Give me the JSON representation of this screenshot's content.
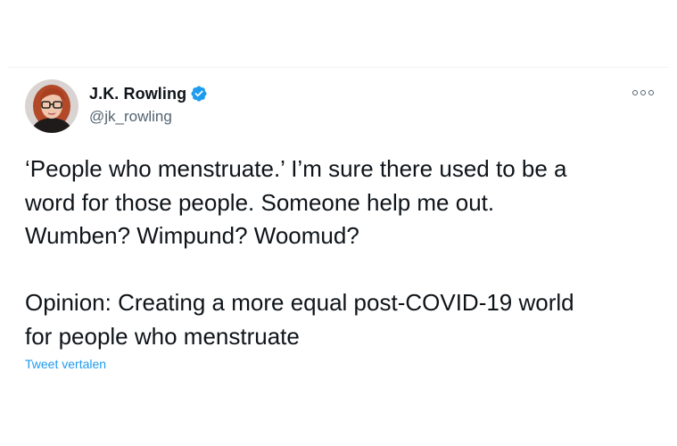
{
  "tweet": {
    "author": {
      "display_name": "J.K. Rowling",
      "handle": "@jk_rowling",
      "verified": true,
      "avatar_icon": "profile-photo-icon"
    },
    "more_icon": "more-options-icon",
    "text_lines_1": [
      "‘People who menstruate.’ I’m sure there used to be a",
      "word for those people. Someone help me out.",
      "Wumben? Wimpund? Woomud?"
    ],
    "text_lines_2": [
      "Opinion: Creating a more equal post-COVID-19 world",
      "for people who menstruate"
    ],
    "translate_label": "Tweet vertalen"
  },
  "colors": {
    "text_primary": "#0f1419",
    "text_secondary": "#536471",
    "accent": "#1d9bf0",
    "divider": "#eff3f4"
  }
}
